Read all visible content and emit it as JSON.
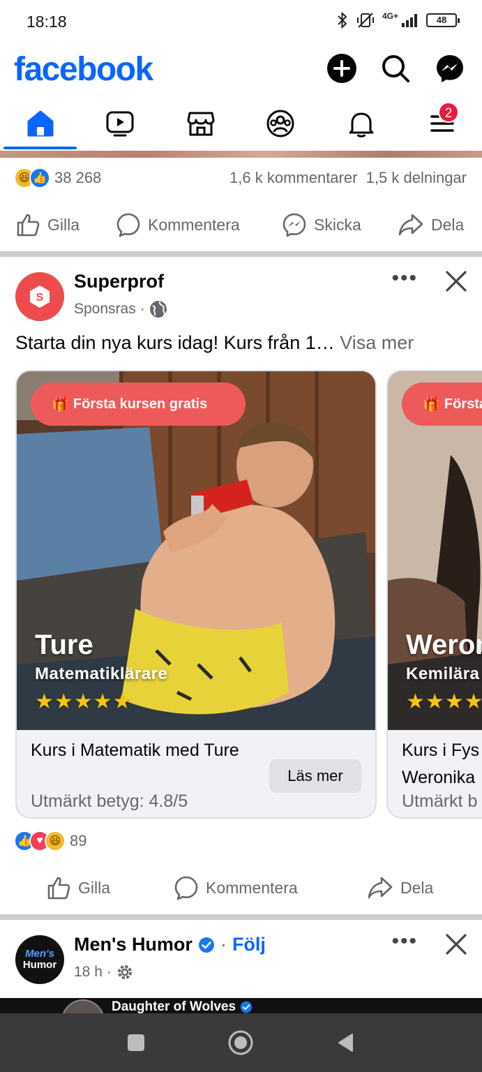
{
  "status_bar": {
    "time": "18:18",
    "network": "4G+",
    "battery": "48"
  },
  "header": {
    "logo": "facebook",
    "brand_color": "#0866ff"
  },
  "tabs": {
    "items": [
      "home-icon",
      "video-icon",
      "marketplace-icon",
      "groups-icon",
      "notifications-icon",
      "menu-icon"
    ],
    "active": "home",
    "menu_badge": "2"
  },
  "post1": {
    "reaction_count": "38 268",
    "comments": "1,6 k kommentarer",
    "shares": "1,5 k delningar",
    "actions": {
      "like": "Gilla",
      "comment": "Kommentera",
      "send": "Skicka",
      "share": "Dela"
    }
  },
  "post2": {
    "poster": "Superprof",
    "meta": "Sponsras",
    "text": "Starta din nya kurs idag! Kurs från 1…",
    "see_more": "Visa mer",
    "cards": [
      {
        "promo": "Första kursen gratis",
        "teacher": "Ture",
        "role": "Matematiklärare",
        "stars": "★★★★★",
        "title": "Kurs i Matematik med Ture",
        "rating": "Utmärkt betyg: 4.8/5",
        "cta": "Läs mer"
      },
      {
        "promo": "Första k",
        "teacher": "Weron",
        "role": "Kemilära",
        "stars": "★★★★",
        "title_line1": "Kurs i Fys",
        "title_line2": "Weronika",
        "rating": "Utmärkt b"
      }
    ],
    "reaction_count": "89",
    "actions": {
      "like": "Gilla",
      "comment": "Kommentera",
      "share": "Dela"
    }
  },
  "post3": {
    "poster": "Men's Humor",
    "follow": "Följ",
    "meta": "18 h",
    "avatar_text_1": "Men's",
    "avatar_text_2": "Humor",
    "preview_text": "Daughter of Wolves"
  }
}
